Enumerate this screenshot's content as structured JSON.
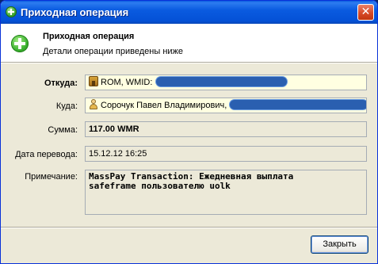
{
  "window": {
    "title": "Приходная операция"
  },
  "header": {
    "title": "Приходная операция",
    "subtitle": "Детали операции приведены ниже"
  },
  "form": {
    "from_label": "Откуда:",
    "from_value": "ROM, WMID:",
    "to_label": "Куда:",
    "to_value": "Сорочук Павел Владимирович,",
    "amount_label": "Сумма:",
    "amount_value": "117.00 WMR",
    "date_label": "Дата перевода:",
    "date_value": "15.12.12 16:25",
    "note_label": "Примечание:",
    "note_value": "MassPay Transaction: Ежедневная выплата\nsafeframe пользователю uolk"
  },
  "buttons": {
    "close_label": "Закрыть"
  },
  "colors": {
    "titlebar": "#0a5be0",
    "highlight_field": "#ffffe1",
    "dialog_bg": "#ece9d8",
    "redaction": "#2a5fb0"
  }
}
